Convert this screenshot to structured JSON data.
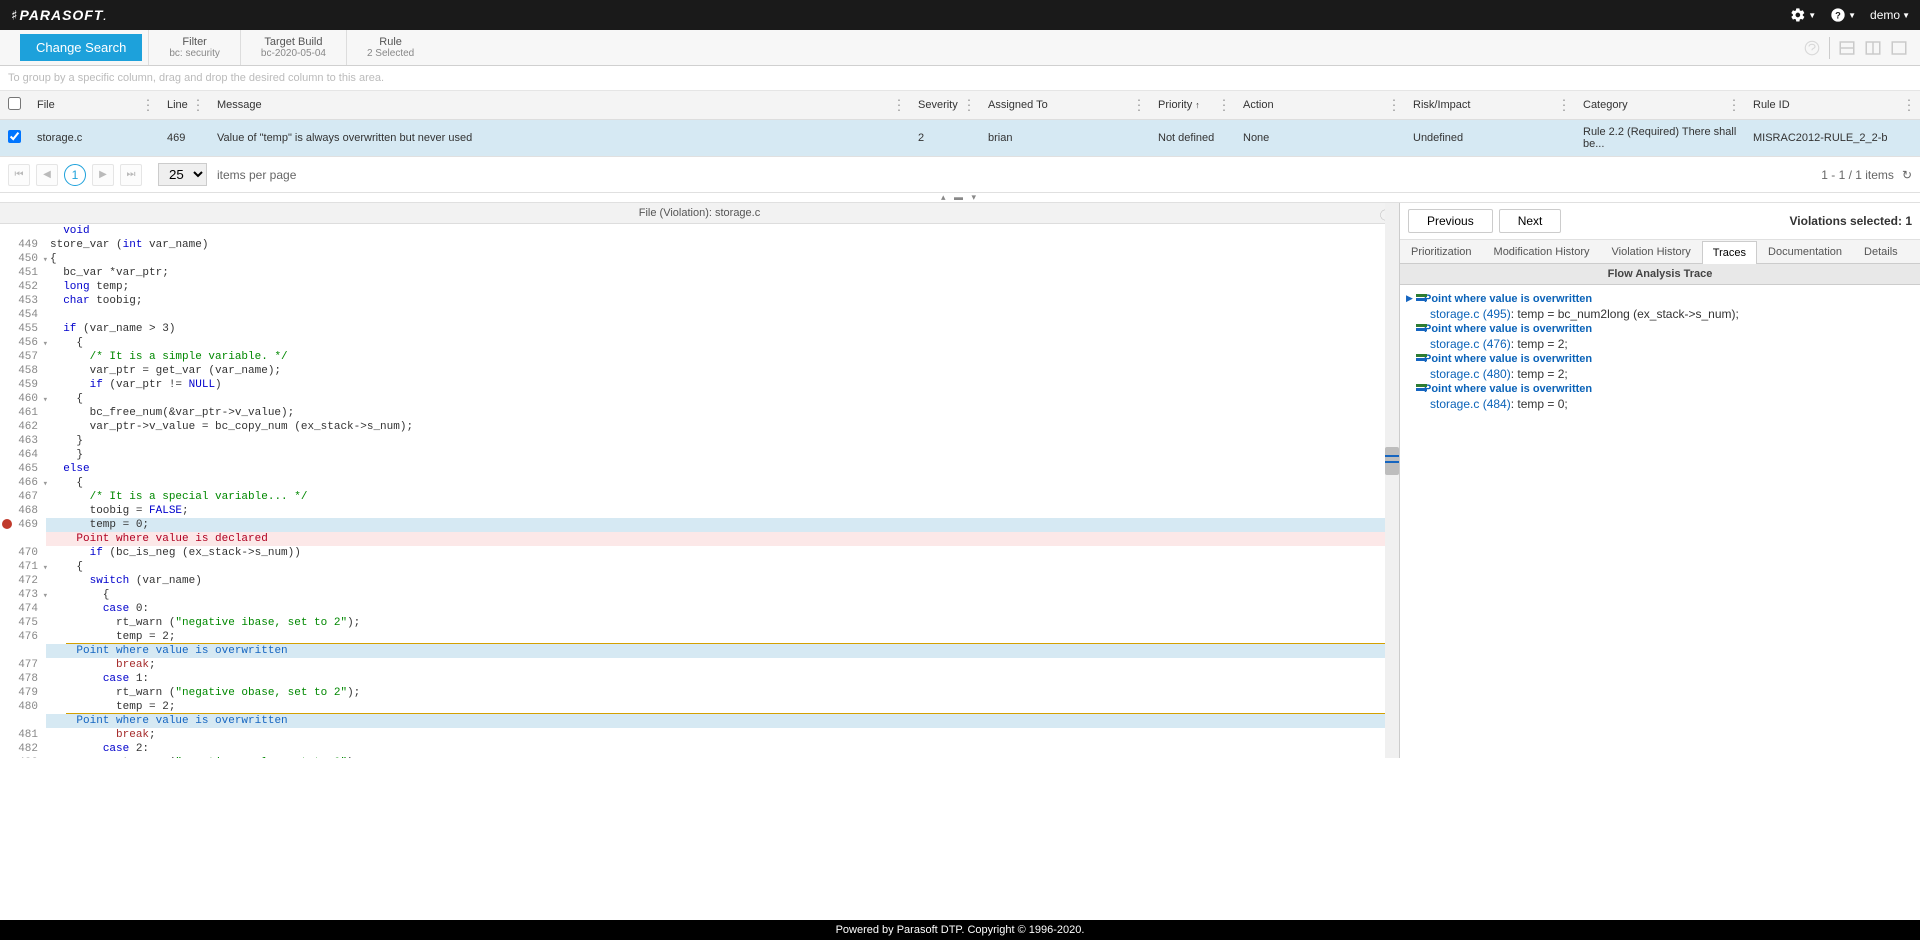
{
  "topbar": {
    "logo": "PARASOFT",
    "user": "demo"
  },
  "filterbar": {
    "changeSearch": "Change Search",
    "items": [
      {
        "label": "Filter",
        "value": "bc: security"
      },
      {
        "label": "Target Build",
        "value": "bc-2020-05-04"
      },
      {
        "label": "Rule",
        "value": "2 Selected"
      }
    ]
  },
  "groupHint": "To group by a specific column, drag and drop the desired column to this area.",
  "columns": [
    "",
    "File",
    "Line",
    "Message",
    "Severity",
    "Assigned To",
    "Priority",
    "Action",
    "Risk/Impact",
    "Category",
    "Rule ID"
  ],
  "row": {
    "file": "storage.c",
    "line": "469",
    "message": "Value of \"temp\" is always overwritten but never used",
    "severity": "2",
    "assigned": "brian",
    "priority": "Not defined",
    "action": "None",
    "risk": "Undefined",
    "category": "Rule 2.2 (Required) There shall be...",
    "ruleid": "MISRAC2012-RULE_2_2-b"
  },
  "pagination": {
    "page": "1",
    "size": "25",
    "label": "items per page",
    "info": "1 - 1 / 1 items"
  },
  "fileHeader": "File (Violation): storage.c",
  "right": {
    "prev": "Previous",
    "next": "Next",
    "selected": "Violations selected: 1",
    "tabs": [
      "Prioritization",
      "Modification History",
      "Violation History",
      "Traces",
      "Documentation",
      "Details"
    ],
    "activeTabIndex": 3,
    "traceTitle": "Flow Analysis Trace",
    "traces": [
      {
        "title": "Point where value is overwritten",
        "sub_link": "storage.c (495)",
        "sub_text": ": temp = bc_num2long (ex_stack->s_num);",
        "expand": true
      },
      {
        "title": "Point where value is overwritten",
        "sub_link": "storage.c (476)",
        "sub_text": ": temp = 2;"
      },
      {
        "title": "Point where value is overwritten",
        "sub_link": "storage.c (480)",
        "sub_text": ": temp = 2;"
      },
      {
        "title": "Point where value is overwritten",
        "sub_link": "storage.c (484)",
        "sub_text": ": temp = 0;"
      }
    ]
  },
  "annotations": {
    "declared": "Point where value is declared",
    "overwritten": "Point where value is overwritten"
  },
  "footer": "Powered by Parasoft DTP. Copyright © 1996-2020."
}
